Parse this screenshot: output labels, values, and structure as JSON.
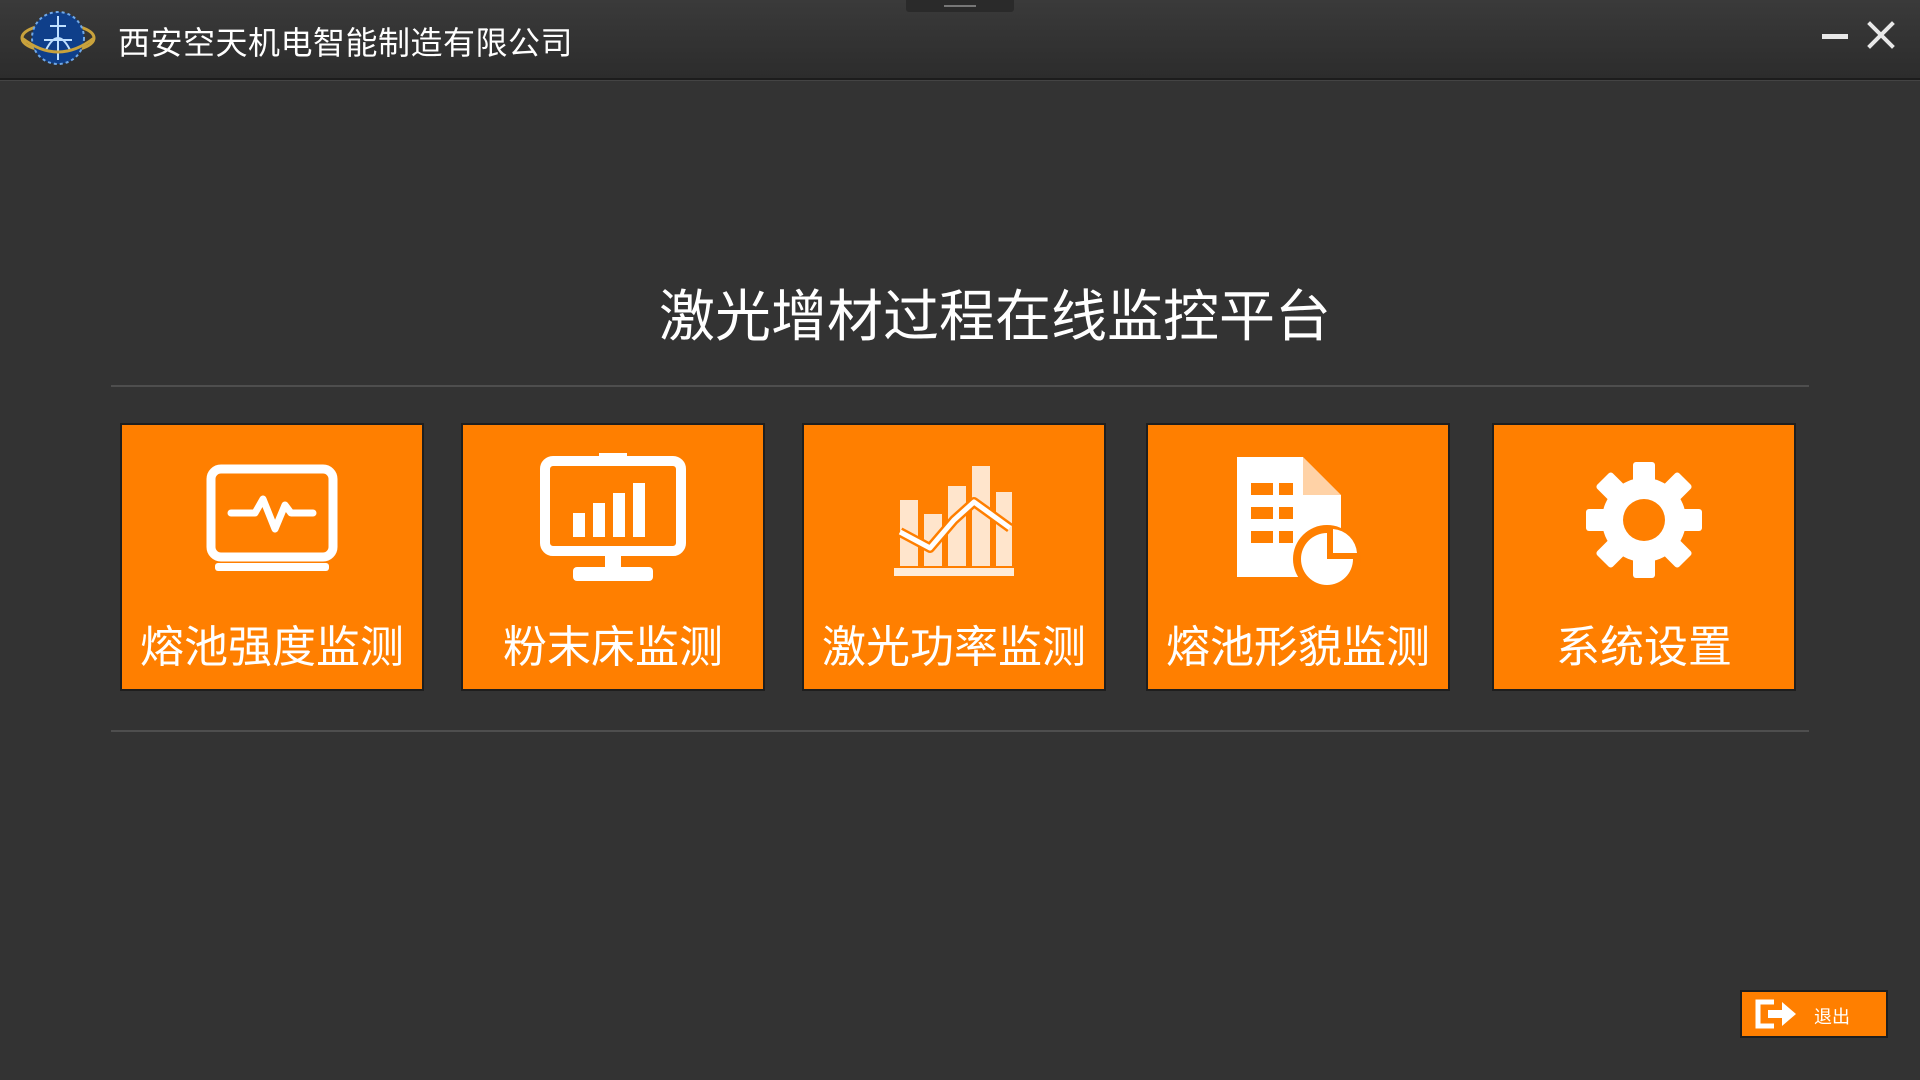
{
  "window": {
    "company_name": "西安空天机电智能制造有限公司",
    "minimize_icon": "minimize-icon",
    "close_icon": "close-icon",
    "logo_icon": "company-logo"
  },
  "main": {
    "title": "激光增材过程在线监控平台",
    "tiles": [
      {
        "label": "熔池强度监测",
        "icon": "monitor-pulse-icon"
      },
      {
        "label": "粉末床监测",
        "icon": "monitor-bar-chart-icon"
      },
      {
        "label": "激光功率监测",
        "icon": "bar-line-chart-icon"
      },
      {
        "label": "熔池形貌监测",
        "icon": "document-pie-icon"
      },
      {
        "label": "系统设置",
        "icon": "gear-icon"
      }
    ]
  },
  "footer": {
    "exit_label": "退出",
    "exit_icon": "exit-icon"
  },
  "colors": {
    "background": "#333333",
    "accent": "#ff7f00",
    "text": "#ffffff"
  }
}
